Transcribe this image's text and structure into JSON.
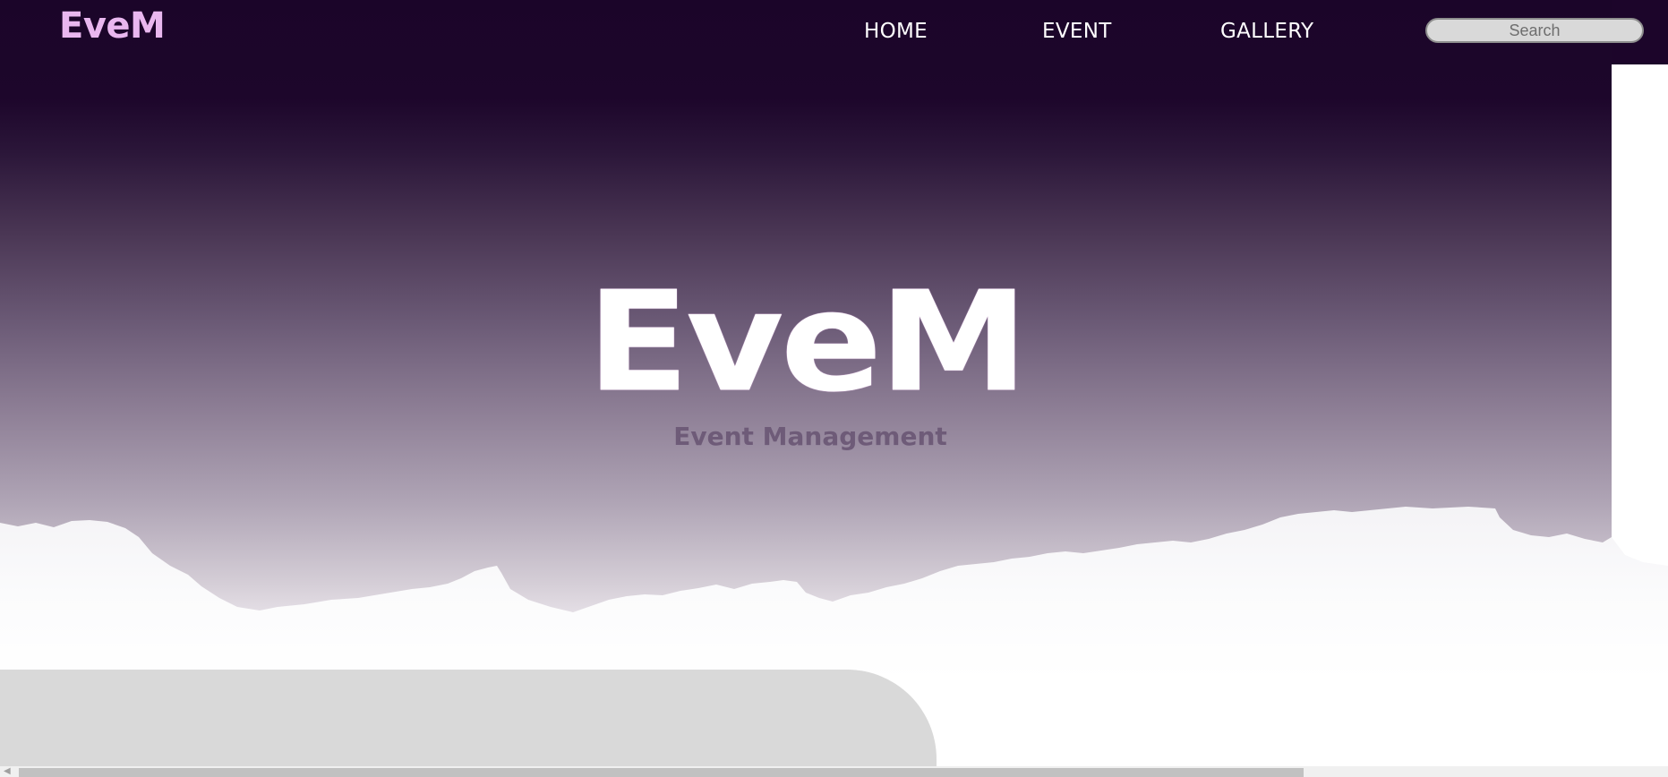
{
  "brand": {
    "logo": "EveM",
    "logo_color": "#e9b7ef"
  },
  "nav": {
    "items": [
      {
        "label": "HOME"
      },
      {
        "label": "EVENT"
      },
      {
        "label": "GALLERY"
      }
    ]
  },
  "search": {
    "placeholder": "Search",
    "value": ""
  },
  "hero": {
    "title": "EveM",
    "subtitle": "Event Management"
  },
  "colors": {
    "nav_background": "#1b0529",
    "hero_gradient_end": "#ebe6ec",
    "subtitle": "#6e5b78",
    "panel": "#d9d9d9"
  },
  "scrollbar": {
    "orientation": "horizontal",
    "left_arrow_icon": "chevron-left-icon"
  }
}
